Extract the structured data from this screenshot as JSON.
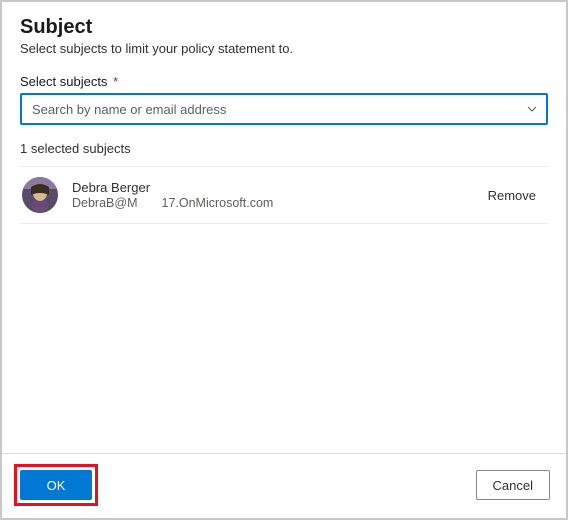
{
  "header": {
    "title": "Subject",
    "subtitle": "Select subjects to limit your policy statement to."
  },
  "search": {
    "label": "Select subjects",
    "required_mark": "*",
    "placeholder": "Search by name or email address"
  },
  "selected_text": "1 selected subjects",
  "items": [
    {
      "name": "Debra Berger",
      "email_part1": "DebraB@M",
      "email_part2": "17.OnMicrosoft.com",
      "remove_label": "Remove"
    }
  ],
  "footer": {
    "ok_label": "OK",
    "cancel_label": "Cancel"
  }
}
